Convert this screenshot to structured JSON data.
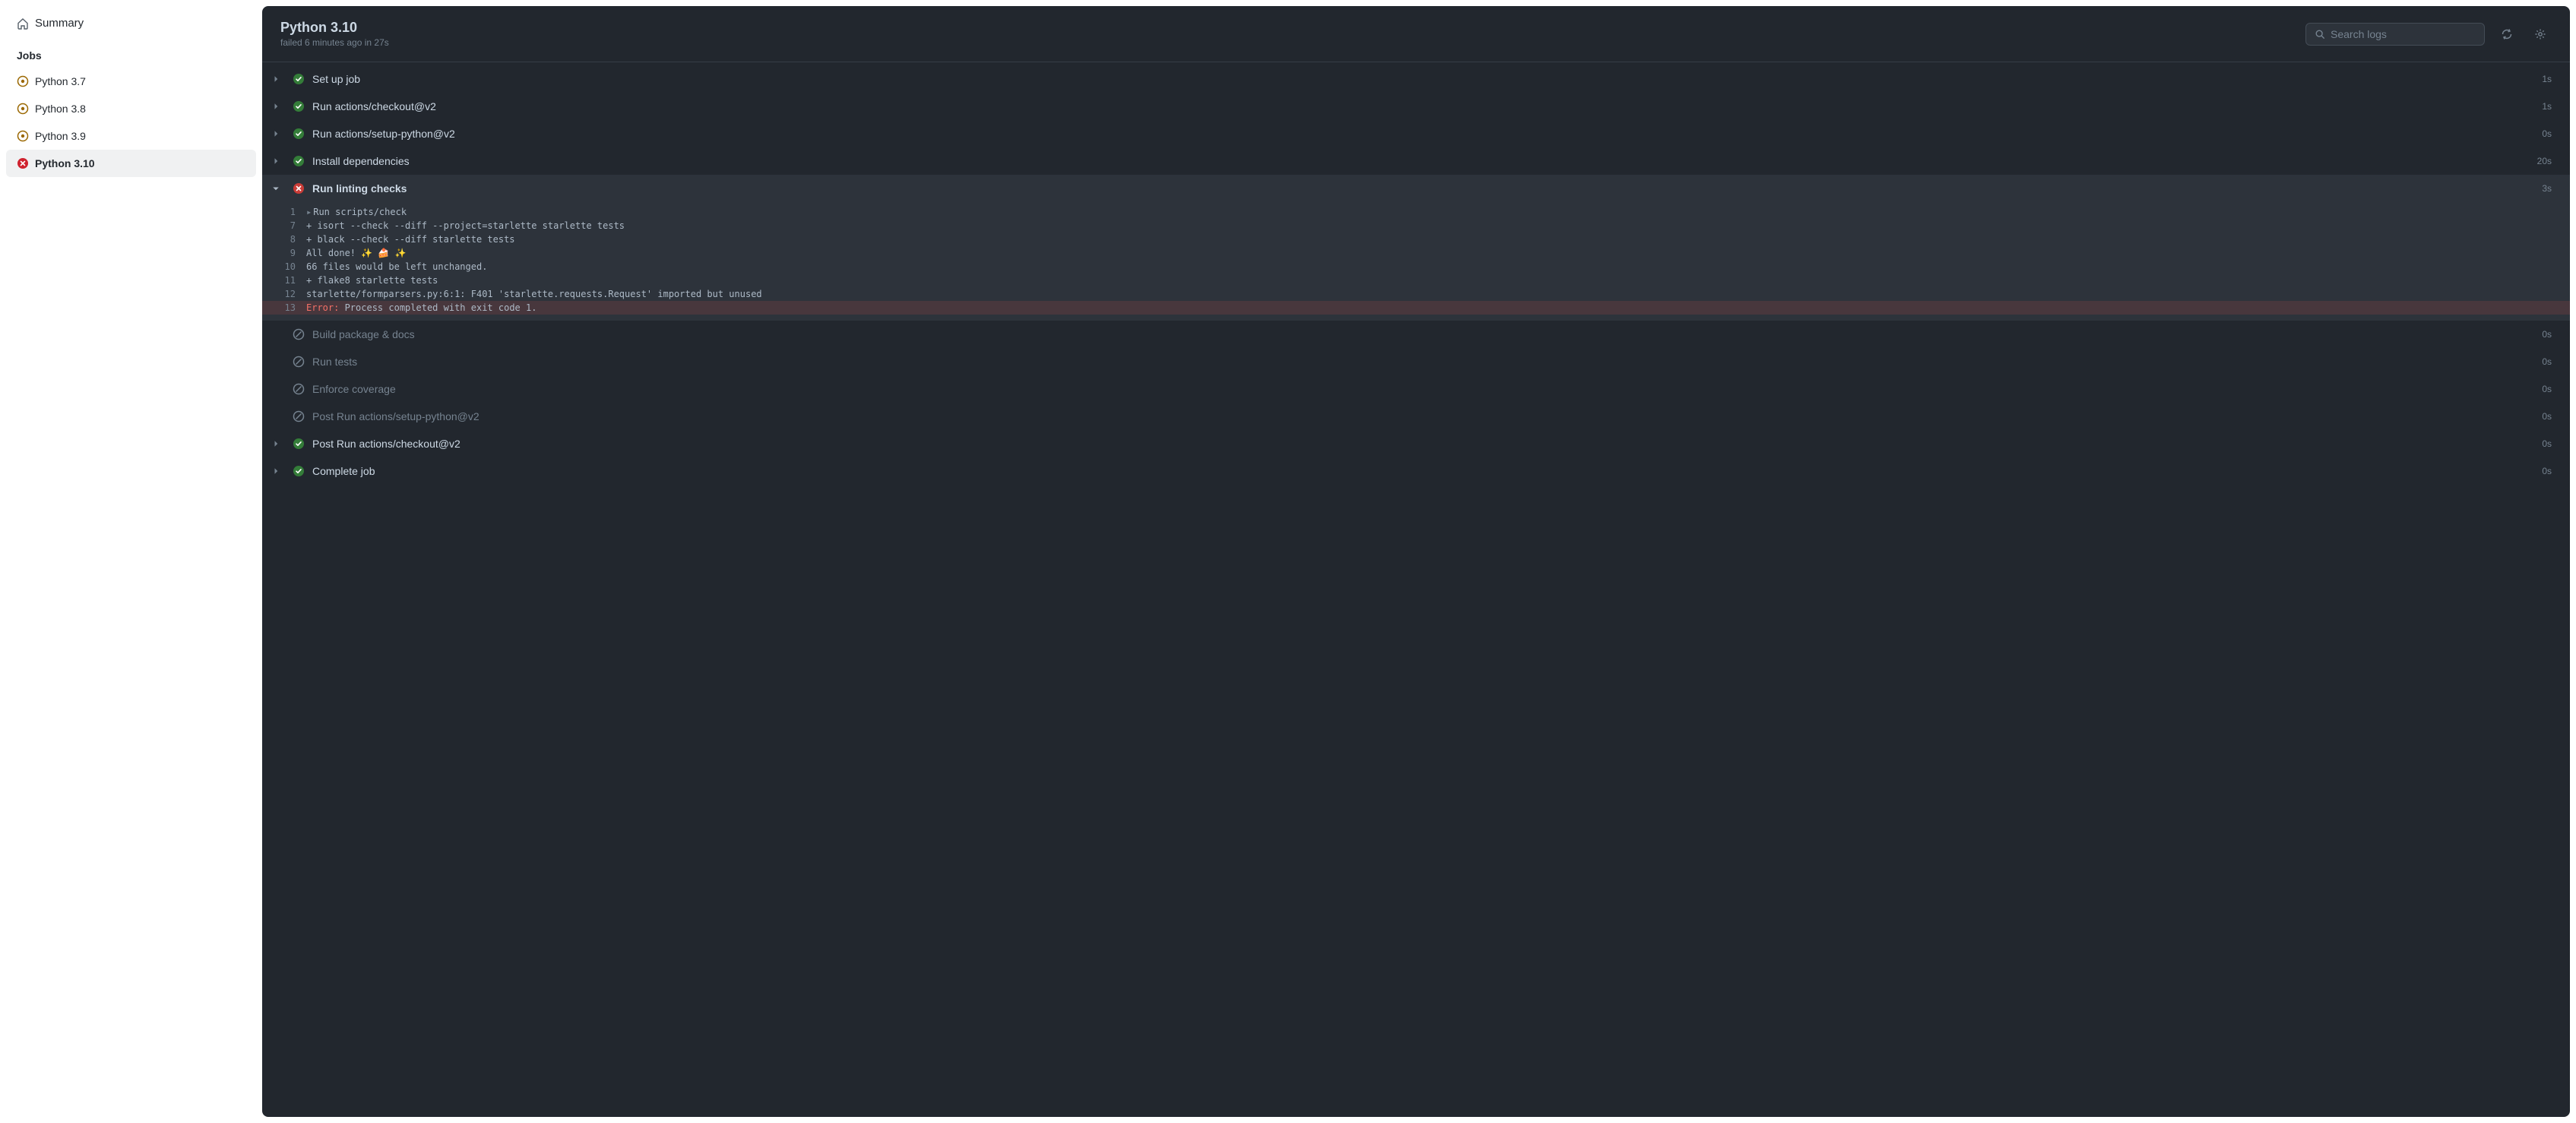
{
  "sidebar": {
    "summary": "Summary",
    "jobs_heading": "Jobs",
    "jobs": [
      {
        "label": "Python 3.7",
        "status": "queued"
      },
      {
        "label": "Python 3.8",
        "status": "queued"
      },
      {
        "label": "Python 3.9",
        "status": "queued"
      },
      {
        "label": "Python 3.10",
        "status": "failed"
      }
    ]
  },
  "header": {
    "title": "Python 3.10",
    "subtitle": "failed 6 minutes ago in 27s",
    "search_placeholder": "Search logs"
  },
  "steps": [
    {
      "name": "Set up job",
      "time": "1s",
      "status": "success",
      "expanded": false
    },
    {
      "name": "Run actions/checkout@v2",
      "time": "1s",
      "status": "success",
      "expanded": false
    },
    {
      "name": "Run actions/setup-python@v2",
      "time": "0s",
      "status": "success",
      "expanded": false
    },
    {
      "name": "Install dependencies",
      "time": "20s",
      "status": "success",
      "expanded": false
    },
    {
      "name": "Run linting checks",
      "time": "3s",
      "status": "failed",
      "expanded": true
    },
    {
      "name": "Build package & docs",
      "time": "0s",
      "status": "skipped",
      "expanded": false
    },
    {
      "name": "Run tests",
      "time": "0s",
      "status": "skipped",
      "expanded": false
    },
    {
      "name": "Enforce coverage",
      "time": "0s",
      "status": "skipped",
      "expanded": false
    },
    {
      "name": "Post Run actions/setup-python@v2",
      "time": "0s",
      "status": "skipped",
      "expanded": false
    },
    {
      "name": "Post Run actions/checkout@v2",
      "time": "0s",
      "status": "success",
      "expanded": false
    },
    {
      "name": "Complete job",
      "time": "0s",
      "status": "success",
      "expanded": false
    }
  ],
  "log": {
    "lines": [
      {
        "n": "1",
        "text": "Run scripts/check",
        "disclosure": true
      },
      {
        "n": "7",
        "text": "+ isort --check --diff --project=starlette starlette tests"
      },
      {
        "n": "8",
        "text": "+ black --check --diff starlette tests"
      },
      {
        "n": "9",
        "text": "All done! ✨ 🍰 ✨"
      },
      {
        "n": "10",
        "text": "66 files would be left unchanged."
      },
      {
        "n": "11",
        "text": "+ flake8 starlette tests"
      },
      {
        "n": "12",
        "text": "starlette/formparsers.py:6:1: F401 'starlette.requests.Request' imported but unused"
      },
      {
        "n": "13",
        "error_label": "Error:",
        "text": " Process completed with exit code 1.",
        "error": true
      }
    ]
  }
}
